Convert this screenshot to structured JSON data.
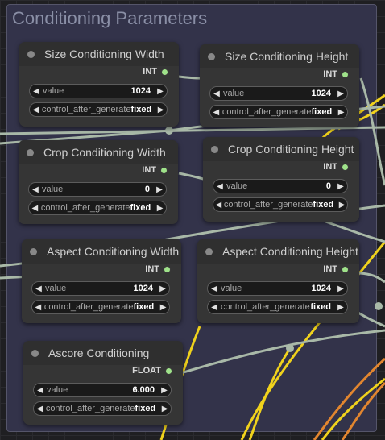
{
  "group_title": "Conditioning Parameters",
  "widget_labels": {
    "value": "value",
    "control": "control_after_generate"
  },
  "nodes": [
    {
      "title": "Size Conditioning Width",
      "output": "INT",
      "value": "1024",
      "control": "fixed"
    },
    {
      "title": "Size Conditioning Height",
      "output": "INT",
      "value": "1024",
      "control": "fixed"
    },
    {
      "title": "Crop Conditioning Width",
      "output": "INT",
      "value": "0",
      "control": "fixed"
    },
    {
      "title": "Crop Conditioning Height",
      "output": "INT",
      "value": "0",
      "control": "fixed"
    },
    {
      "title": "Aspect Conditioning Width",
      "output": "INT",
      "value": "1024",
      "control": "fixed"
    },
    {
      "title": "Aspect Conditioning Height",
      "output": "INT",
      "value": "1024",
      "control": "fixed"
    },
    {
      "title": "Ascore Conditioning",
      "output": "FLOAT",
      "value": "6.000",
      "control": "fixed"
    }
  ],
  "colors": {
    "port_int": "#9fe28a",
    "wire_int": "#a9b9a8",
    "wire_yellow": "#f0d21c",
    "wire_orange": "#e2862f"
  }
}
